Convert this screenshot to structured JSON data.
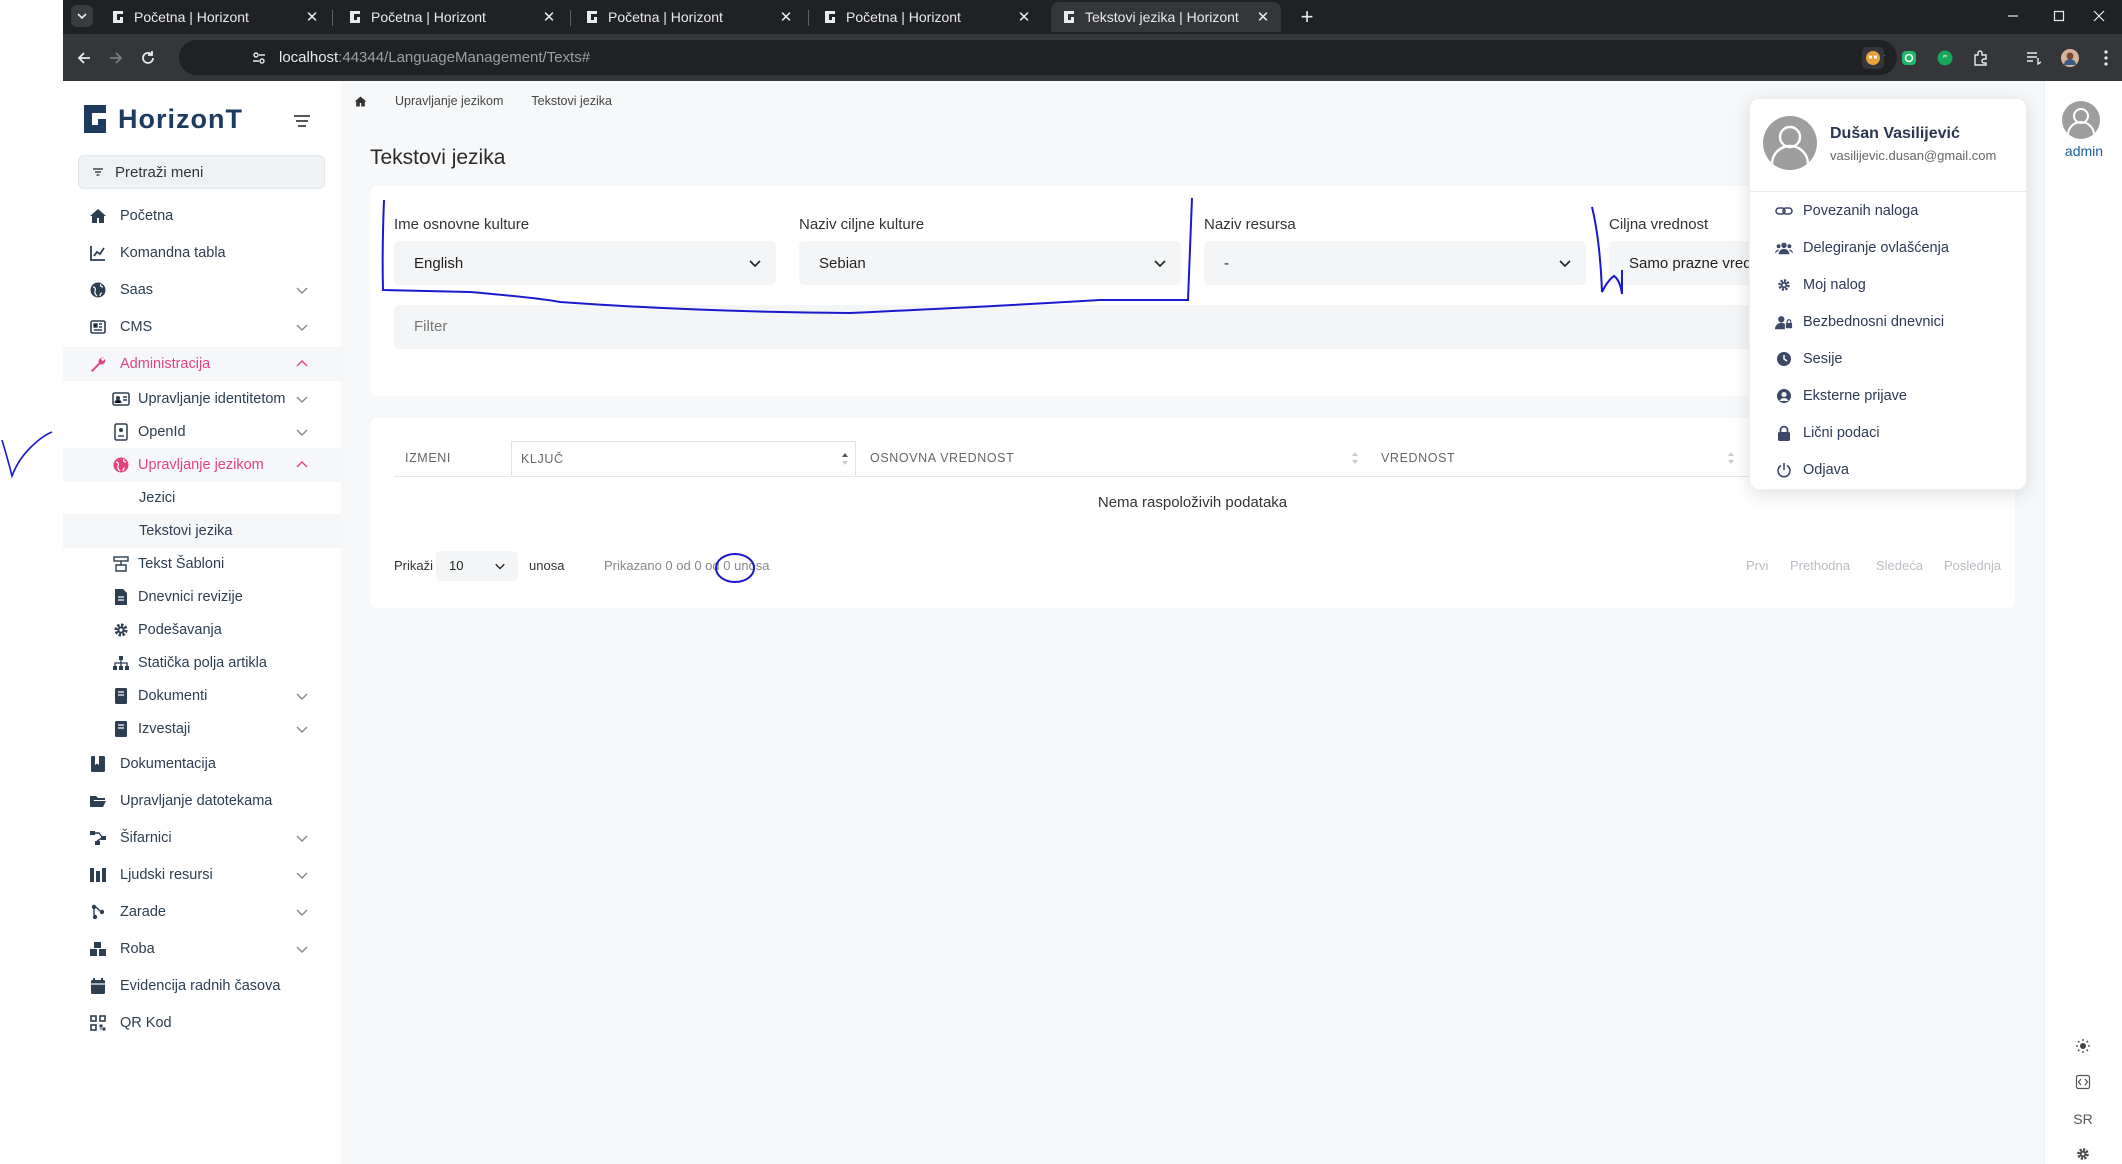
{
  "browser": {
    "tabs": [
      {
        "title": "Početna | Horizont",
        "active": false
      },
      {
        "title": "Početna | Horizont",
        "active": false
      },
      {
        "title": "Početna | Horizont",
        "active": false
      },
      {
        "title": "Početna | Horizont",
        "active": false
      },
      {
        "title": "Tekstovi jezika | Horizont",
        "active": true
      }
    ],
    "url_host": "localhost",
    "url_rest": ":44344/LanguageManagement/Texts#"
  },
  "sidebar": {
    "brand": "HorizonT",
    "search_label": "Pretraži meni",
    "items": [
      {
        "label": "Početna",
        "icon": "home-icon"
      },
      {
        "label": "Komandna tabla",
        "icon": "chart-line-icon"
      },
      {
        "label": "Saas",
        "icon": "globe-icon"
      },
      {
        "label": "CMS",
        "icon": "newspaper-icon"
      },
      {
        "label": "Administracija",
        "icon": "wrench-icon"
      },
      {
        "label": "Upravljanje identitetom",
        "icon": "id-card-icon"
      },
      {
        "label": "OpenId",
        "icon": "openid-icon"
      },
      {
        "label": "Upravljanje jezikom",
        "icon": "language-globe-icon"
      },
      {
        "label": "Jezici"
      },
      {
        "label": "Tekstovi jezika"
      },
      {
        "label": "Tekst Šabloni",
        "icon": "template-icon"
      },
      {
        "label": "Dnevnici revizije",
        "icon": "file-icon"
      },
      {
        "label": "Podešavanja",
        "icon": "gear-icon"
      },
      {
        "label": "Statička polja artikla",
        "icon": "sitemap-icon"
      },
      {
        "label": "Dokumenti",
        "icon": "book-icon"
      },
      {
        "label": "Izvestaji",
        "icon": "book-icon"
      },
      {
        "label": "Dokumentacija",
        "icon": "book-open-icon"
      },
      {
        "label": "Upravljanje datotekama",
        "icon": "folder-open-icon"
      },
      {
        "label": "Šifarnici",
        "icon": "diagram-icon"
      },
      {
        "label": "Ljudski resursi",
        "icon": "hr-icon"
      },
      {
        "label": "Zarade",
        "icon": "money-icon"
      },
      {
        "label": "Roba",
        "icon": "boxes-icon"
      },
      {
        "label": "Evidencija radnih časova",
        "icon": "calendar-icon"
      },
      {
        "label": "QR Kod",
        "icon": "qr-code-icon"
      }
    ]
  },
  "breadcrumb": {
    "items": [
      "Upravljanje jezikom",
      "Tekstovi jezika"
    ]
  },
  "page": {
    "title": "Tekstovi jezika",
    "filters": [
      {
        "label": "Ime osnovne kulture",
        "value": "English"
      },
      {
        "label": "Naziv ciljne kulture",
        "value": "Sebian"
      },
      {
        "label": "Naziv resursa",
        "value": "-"
      },
      {
        "label": "Ciljna vrednost",
        "value": "Samo prazne vrednosti"
      }
    ],
    "filter_placeholder": "Filter",
    "table": {
      "columns": [
        "IZMENI",
        "KLJUČ",
        "OSNOVNA VREDNOST",
        "VREDNOST"
      ],
      "empty_message": "Nema raspoloživih podataka",
      "show_label": "Prikaži",
      "page_size": "10",
      "entries_label": "unosa",
      "info": "Prikazano 0 od 0 od 0 unosa",
      "pager": [
        "Prvi",
        "Prethodna",
        "Sledeća",
        "Poslednja"
      ]
    }
  },
  "user": {
    "name": "Dušan Vasilijević",
    "email": "vasilijevic.dusan@gmail.com",
    "short_label": "admin",
    "menu": [
      {
        "label": "Povezanih naloga",
        "icon": "link-icon"
      },
      {
        "label": "Delegiranje ovlašćenja",
        "icon": "users-icon"
      },
      {
        "label": "Moj nalog",
        "icon": "gear-icon"
      },
      {
        "label": "Bezbednosni dnevnici",
        "icon": "user-lock-icon"
      },
      {
        "label": "Sesije",
        "icon": "clock-icon"
      },
      {
        "label": "Eksterne prijave",
        "icon": "user-circle-icon"
      },
      {
        "label": "Lični podaci",
        "icon": "lock-icon"
      },
      {
        "label": "Odjava",
        "icon": "power-icon"
      }
    ]
  },
  "rail": {
    "language": "SR"
  },
  "colors": {
    "accent": "#e0457b",
    "brand": "#1c3b5f",
    "annotation": "#1a1acc"
  }
}
